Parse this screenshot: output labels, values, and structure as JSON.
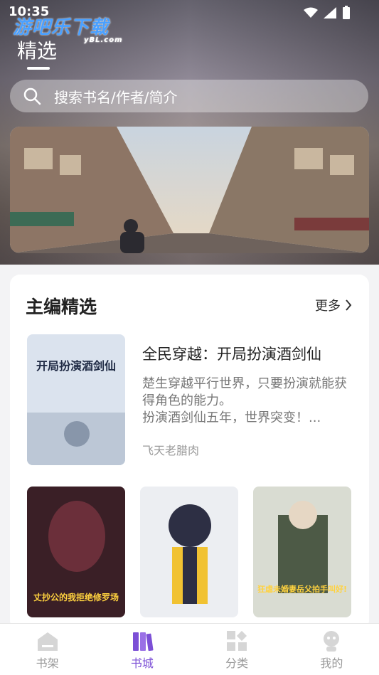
{
  "status_bar": {
    "time": "10:35"
  },
  "watermark": {
    "brand": "游吧乐下载",
    "site": "yBL.com"
  },
  "header": {
    "tab": "精选"
  },
  "search": {
    "placeholder": "搜索书名/作者/简介"
  },
  "editor_picks": {
    "title": "主编精选",
    "more_label": "更多",
    "featured": {
      "title": "全民穿越：开局扮演酒剑仙",
      "description": "楚生穿越平行世界，只要扮演就能获得角色的能力。\n扮演酒剑仙五年，世界突变！...",
      "author": "飞天老腊肉",
      "cover_text": "开局扮演酒剑仙"
    },
    "covers": [
      {
        "text": "丈抄公的我拒绝修罗场"
      },
      {
        "text": ""
      },
      {
        "text": "狂虐未婚妻岳父拍手叫好!"
      }
    ]
  },
  "bottom_nav": {
    "items": [
      {
        "label": "书架"
      },
      {
        "label": "书城"
      },
      {
        "label": "分类"
      },
      {
        "label": "我的"
      }
    ],
    "active_color": "#7c4fd6",
    "inactive_color": "#999999"
  }
}
